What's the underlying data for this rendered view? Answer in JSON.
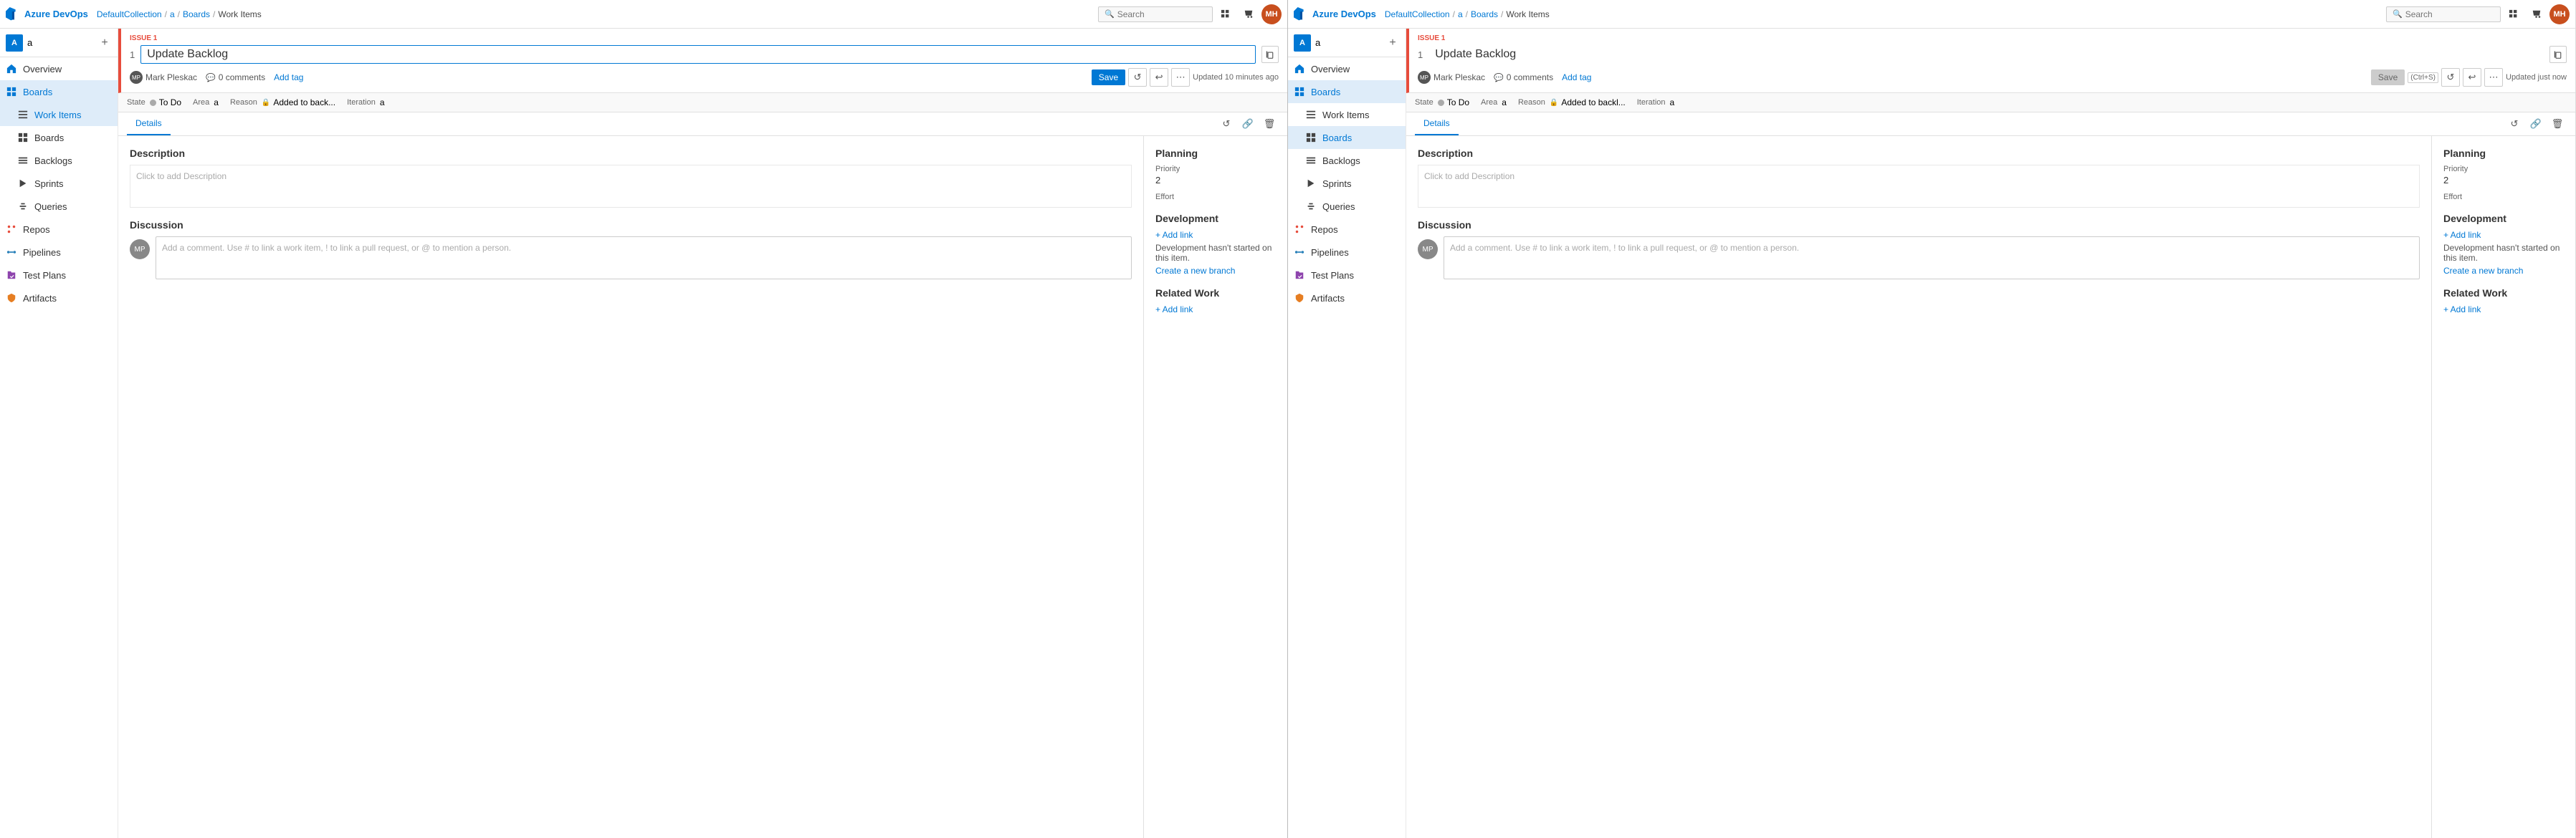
{
  "panes": [
    {
      "id": "pane-left",
      "topbar": {
        "brand": "Azure DevOps",
        "breadcrumb": [
          "DefaultCollection",
          "a",
          "Boards",
          "Work Items"
        ],
        "search_placeholder": "Search",
        "topbar_icons": [
          "grid-icon",
          "shop-icon"
        ],
        "avatar_initials": "MH"
      },
      "sidebar": {
        "project_name": "a",
        "project_initial": "a",
        "items": [
          {
            "id": "overview",
            "label": "Overview",
            "icon": "home"
          },
          {
            "id": "boards",
            "label": "Boards",
            "icon": "boards",
            "active": true,
            "section": true
          },
          {
            "id": "work-items",
            "label": "Work Items",
            "icon": "list",
            "active": true,
            "sub": true
          },
          {
            "id": "boards-sub",
            "label": "Boards",
            "icon": "grid2",
            "sub": true
          },
          {
            "id": "backlogs",
            "label": "Backlogs",
            "icon": "backlogs",
            "sub": true
          },
          {
            "id": "sprints",
            "label": "Sprints",
            "icon": "sprints",
            "sub": true
          },
          {
            "id": "queries",
            "label": "Queries",
            "icon": "queries",
            "sub": true
          },
          {
            "id": "repos",
            "label": "Repos",
            "icon": "repos"
          },
          {
            "id": "pipelines",
            "label": "Pipelines",
            "icon": "pipelines"
          },
          {
            "id": "test-plans",
            "label": "Test Plans",
            "icon": "test-plans"
          },
          {
            "id": "artifacts",
            "label": "Artifacts",
            "icon": "artifacts"
          }
        ]
      },
      "work_item": {
        "issue_label": "ISSUE 1",
        "item_number": "1",
        "title": "Update Backlog",
        "author": "Mark Pleskac",
        "comments_count": "0 comments",
        "add_tag": "Add tag",
        "save_label": "Save",
        "state": "To Do",
        "area": "a",
        "reason": "Added to back...",
        "iteration": "a",
        "timestamp": "Updated 10 minutes ago",
        "tabs": {
          "details": "Details",
          "history_icon": "↺",
          "link_icon": "🔗",
          "delete_icon": "🗑"
        },
        "description_title": "Description",
        "description_placeholder": "Click to add Description",
        "planning_title": "Planning",
        "priority_label": "Priority",
        "priority_value": "2",
        "effort_label": "Effort",
        "effort_value": "",
        "discussion_title": "Discussion",
        "comment_placeholder": "Add a comment. Use # to link a work item, ! to link a pull request, or @ to mention a person.",
        "development_title": "Development",
        "add_link_label": "+ Add link",
        "dev_note": "Development hasn't started on this item.",
        "create_branch": "Create a new branch",
        "related_work_title": "Related Work",
        "related_add_link": "+ Add link",
        "author_initials": "MP",
        "state_dot_color": "gray",
        "save_active": true
      }
    },
    {
      "id": "pane-right",
      "topbar": {
        "brand": "Azure DevOps",
        "breadcrumb": [
          "DefaultCollection",
          "a",
          "Boards",
          "Work Items"
        ],
        "search_placeholder": "Search",
        "topbar_icons": [
          "grid-icon",
          "shop-icon"
        ],
        "avatar_initials": "MH"
      },
      "sidebar": {
        "project_name": "a",
        "project_initial": "a",
        "items": [
          {
            "id": "overview",
            "label": "Overview",
            "icon": "home"
          },
          {
            "id": "boards",
            "label": "Boards",
            "icon": "boards",
            "section": true,
            "active": true
          },
          {
            "id": "work-items",
            "label": "Work Items",
            "icon": "list",
            "sub": true
          },
          {
            "id": "boards-sub",
            "label": "Boards",
            "icon": "grid2",
            "sub": true,
            "active": true
          },
          {
            "id": "backlogs",
            "label": "Backlogs",
            "icon": "backlogs",
            "sub": true
          },
          {
            "id": "sprints",
            "label": "Sprints",
            "icon": "sprints",
            "sub": true
          },
          {
            "id": "queries",
            "label": "Queries",
            "icon": "queries",
            "sub": true
          },
          {
            "id": "repos",
            "label": "Repos",
            "icon": "repos"
          },
          {
            "id": "pipelines",
            "label": "Pipelines",
            "icon": "pipelines"
          },
          {
            "id": "test-plans",
            "label": "Test Plans",
            "icon": "test-plans"
          },
          {
            "id": "artifacts",
            "label": "Artifacts",
            "icon": "artifacts"
          }
        ]
      },
      "work_item": {
        "issue_label": "ISSUE 1",
        "item_number": "1",
        "title": "Update Backlog",
        "author": "Mark Pleskac",
        "comments_count": "0 comments",
        "add_tag": "Add tag",
        "save_label": "Save",
        "ctrl_s_hint": "(Ctrl+S)",
        "state": "To Do",
        "area": "a",
        "reason": "Added to backl...",
        "iteration": "a",
        "timestamp": "Updated just now",
        "tabs": {
          "details": "Details",
          "history_icon": "↺",
          "link_icon": "🔗",
          "delete_icon": "🗑"
        },
        "description_title": "Description",
        "description_placeholder": "Click to add Description",
        "planning_title": "Planning",
        "priority_label": "Priority",
        "priority_value": "2",
        "effort_label": "Effort",
        "effort_value": "",
        "discussion_title": "Discussion",
        "comment_placeholder": "Add a comment. Use # to link a work item, ! to link a pull request, or @ to mention a person.",
        "development_title": "Development",
        "add_link_label": "+ Add link",
        "dev_note": "Development hasn't started on this item.",
        "create_branch": "Create a new branch",
        "related_work_title": "Related Work",
        "related_add_link": "+ Add link",
        "author_initials": "MP",
        "state_dot_color": "gray",
        "save_active": false
      }
    }
  ],
  "icons": {
    "home": "⌂",
    "boards": "▦",
    "list": "☰",
    "grid2": "▦",
    "backlogs": "≡",
    "sprints": "▷",
    "queries": "⚡",
    "repos": "⎇",
    "pipelines": "⑃",
    "test-plans": "✓",
    "artifacts": "📦",
    "search": "🔍"
  }
}
